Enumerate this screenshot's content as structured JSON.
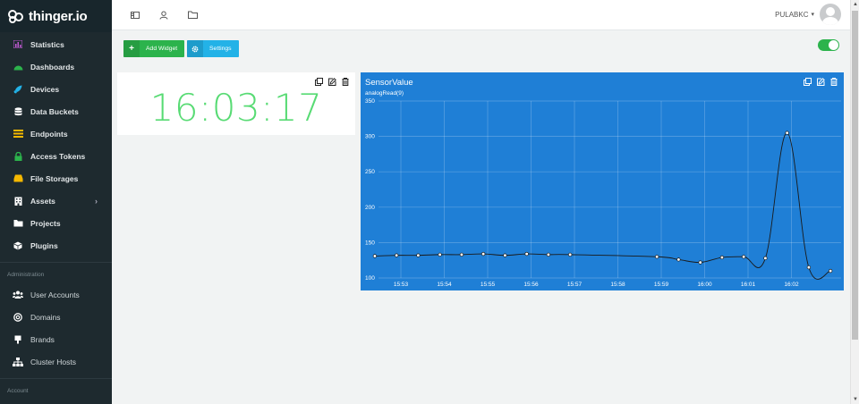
{
  "app": {
    "name": "thinger.io"
  },
  "sidebar": {
    "items": [
      {
        "label": "Statistics",
        "icon": "bar-chart-icon",
        "color": "#c35bd4"
      },
      {
        "label": "Dashboards",
        "icon": "dashboard-icon",
        "color": "#2cb34c"
      },
      {
        "label": "Devices",
        "icon": "rocket-icon",
        "color": "#23b2e7"
      },
      {
        "label": "Data Buckets",
        "icon": "database-icon",
        "color": "#ffffff"
      },
      {
        "label": "Endpoints",
        "icon": "endpoints-icon",
        "color": "#f5b800"
      },
      {
        "label": "Access Tokens",
        "icon": "lock-icon",
        "color": "#2cb34c"
      },
      {
        "label": "File Storages",
        "icon": "hdd-icon",
        "color": "#f5b800"
      },
      {
        "label": "Assets",
        "icon": "building-icon",
        "color": "#ffffff",
        "has_submenu": true
      },
      {
        "label": "Projects",
        "icon": "folder-icon",
        "color": "#ffffff"
      },
      {
        "label": "Plugins",
        "icon": "plugin-icon",
        "color": "#ffffff"
      }
    ],
    "admin_heading": "Administration",
    "admin_items": [
      {
        "label": "User Accounts",
        "icon": "users-icon"
      },
      {
        "label": "Domains",
        "icon": "at-icon"
      },
      {
        "label": "Brands",
        "icon": "brand-icon"
      },
      {
        "label": "Cluster Hosts",
        "icon": "sitemap-icon"
      }
    ],
    "account_heading": "Account"
  },
  "topbar": {
    "icons": [
      "toggle-sidebar-icon",
      "user-icon",
      "folder-icon"
    ],
    "username": "PULABKC"
  },
  "toolbar": {
    "add_widget_label": "Add Widget",
    "settings_label": "Settings",
    "edit_mode_enabled": true
  },
  "clock_widget": {
    "time": "16:03:17",
    "color": "#58db74"
  },
  "chart_widget": {
    "title": "SensorValue",
    "background": "#1f7fd6"
  },
  "chart_data": {
    "type": "line",
    "title": "SensorValue",
    "series": [
      {
        "name": "analogRead(9)",
        "x": [
          "15:52:24",
          "15:52:54",
          "15:53:24",
          "15:53:54",
          "15:54:24",
          "15:54:54",
          "15:55:24",
          "15:55:54",
          "15:56:24",
          "15:56:54",
          "15:58:54",
          "15:59:24",
          "15:59:54",
          "16:00:24",
          "16:00:54",
          "16:01:24",
          "16:01:54",
          "16:02:24",
          "16:02:54"
        ],
        "values": [
          131,
          132,
          132,
          133,
          133,
          134,
          132,
          134,
          133,
          133,
          130,
          126,
          122,
          129,
          130,
          128,
          305,
          115,
          110
        ]
      }
    ],
    "x_ticks": [
      "15:53",
      "15:54",
      "15:55",
      "15:56",
      "15:57",
      "15:58",
      "15:59",
      "16:00",
      "16:01",
      "16:02"
    ],
    "y_ticks": [
      100,
      150,
      200,
      250,
      300,
      350
    ],
    "xlim": [
      "15:52:24",
      "15:53:00"
    ],
    "ylim": [
      100,
      350
    ],
    "grid": true,
    "legend": "none"
  }
}
